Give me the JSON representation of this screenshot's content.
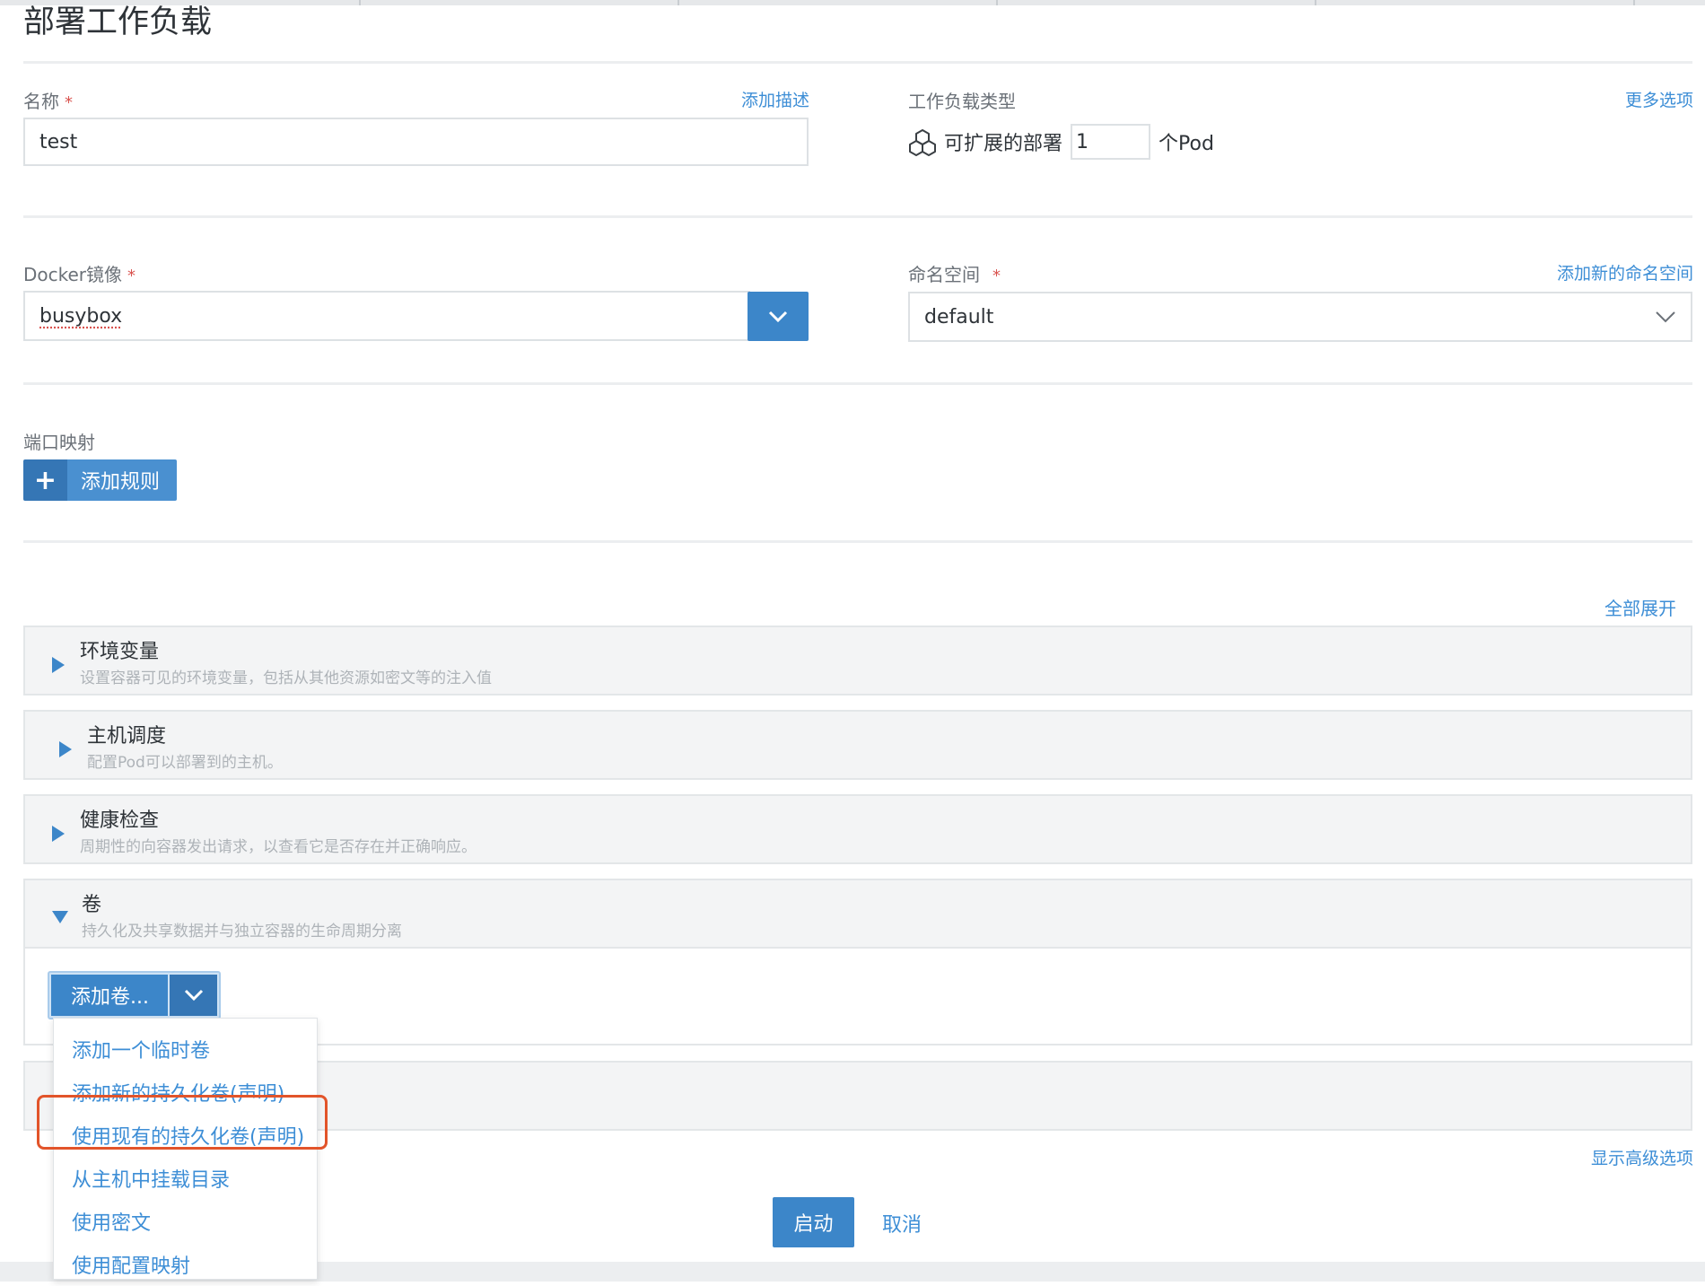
{
  "page": {
    "title": "部署工作负载"
  },
  "name_field": {
    "label": "名称",
    "required_mark": "*",
    "add_description": "添加描述",
    "value": "test"
  },
  "workload_type": {
    "label": "工作负载类型",
    "more_options": "更多选项",
    "type_label": "可扩展的部署",
    "count": "1",
    "suffix": "个Pod"
  },
  "image_field": {
    "label": "Docker镜像",
    "required_mark": "*",
    "value": "busybox"
  },
  "namespace_field": {
    "label": "命名空间",
    "required_mark": "*",
    "add_new": "添加新的命名空间",
    "value": "default"
  },
  "ports": {
    "label": "端口映射",
    "add_rule": "添加规则",
    "plus": "+"
  },
  "expand_all": "全部展开",
  "sections": [
    {
      "title": "环境变量",
      "desc": "设置容器可见的环境变量，包括从其他资源如密文等的注入值"
    },
    {
      "title": "主机调度",
      "desc": "配置Pod可以部署到的主机。"
    },
    {
      "title": "健康检查",
      "desc": "周期性的向容器发出请求，以查看它是否存在并正确响应。"
    },
    {
      "title": "卷",
      "desc": "持久化及共享数据并与独立容器的生命周期分离"
    }
  ],
  "volumes": {
    "add_button": "添加卷...",
    "menu": [
      "添加一个临时卷",
      "添加新的持久化卷(声明)",
      "使用现有的持久化卷(声明)",
      "从主机中挂载目录",
      "使用密文",
      "使用配置映射"
    ]
  },
  "advanced": "显示高级选项",
  "footer": {
    "launch": "启动",
    "cancel": "取消"
  },
  "colors": {
    "accent": "#3c86c9",
    "link": "#3d8ed6",
    "highlight": "#e2542a"
  }
}
